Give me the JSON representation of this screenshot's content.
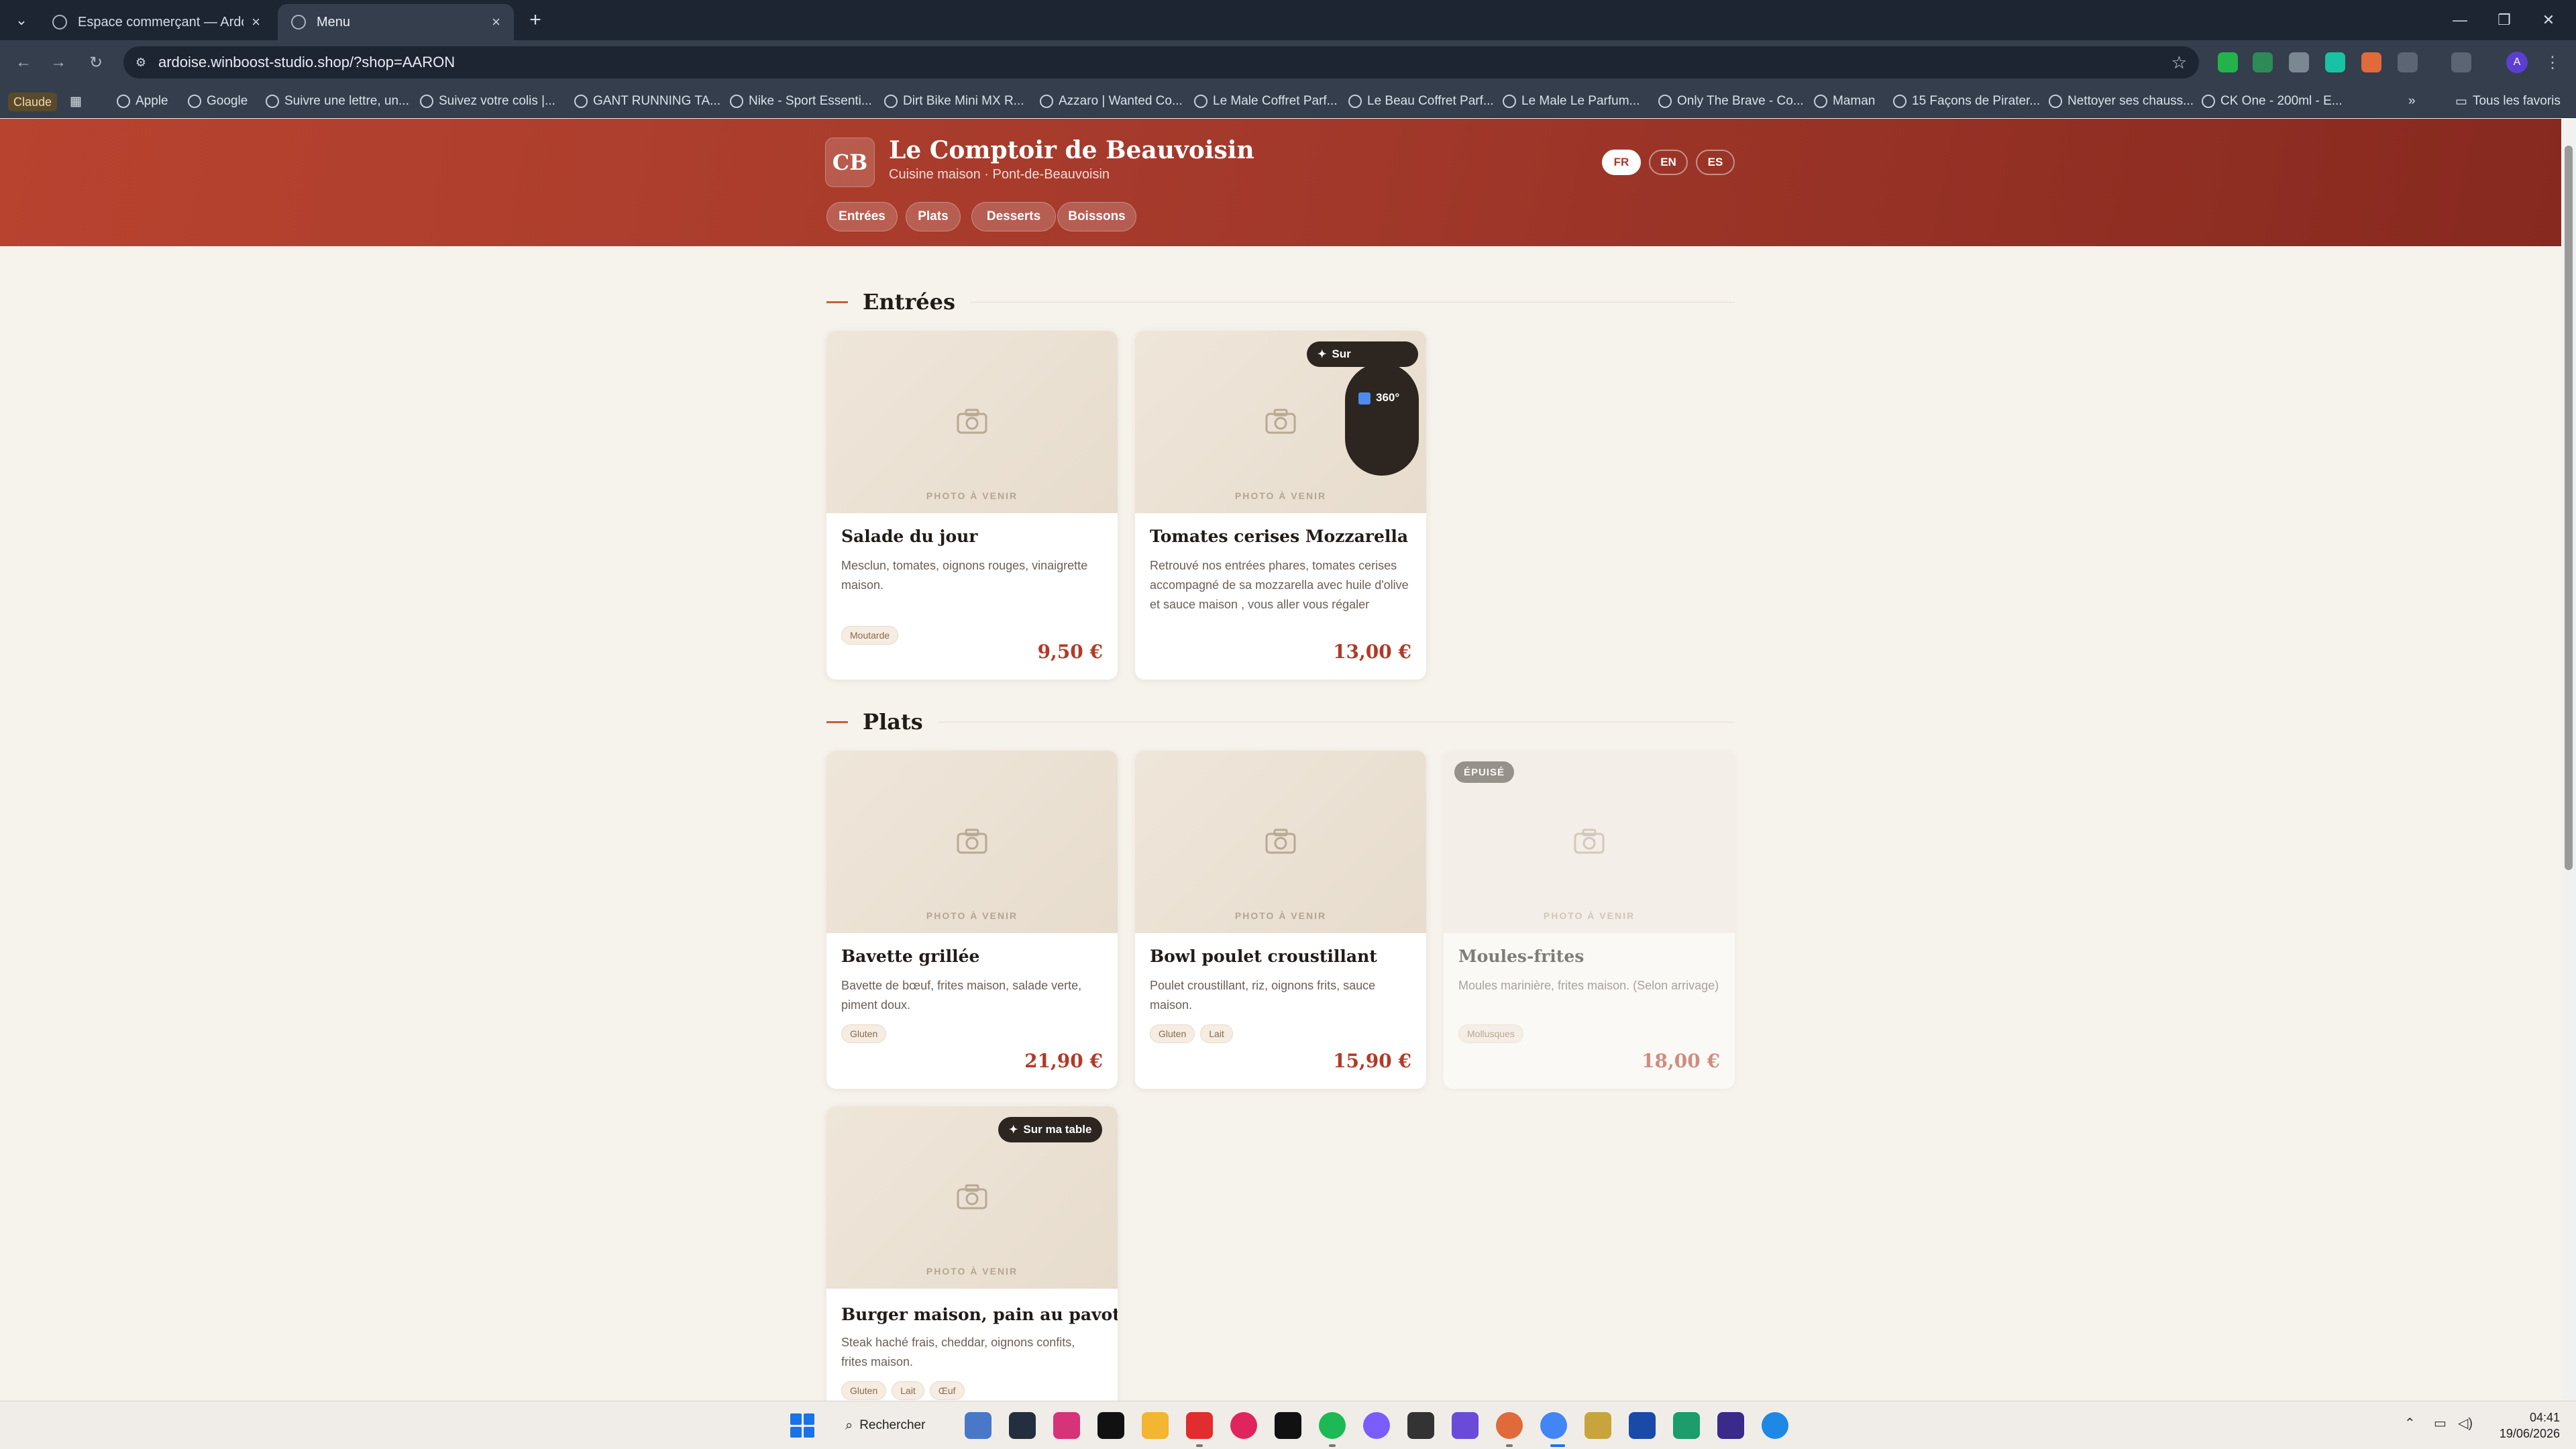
{
  "browser": {
    "tabs": [
      {
        "title": "Espace commerçant — Ardoise",
        "active": false
      },
      {
        "title": "Menu",
        "active": true
      }
    ],
    "url": "ardoise.winboost-studio.shop/?shop=AARON",
    "profile_initial": "A",
    "bookmarks": [
      "Claude",
      "Apple",
      "Google",
      "Suivre une lettre, un...",
      "Suivez votre colis |...",
      "GANT RUNNING TA...",
      "Nike - Sport Essenti...",
      "Dirt Bike Mini MX R...",
      "Azzaro | Wanted Co...",
      "Le Male Coffret Parf...",
      "Le Beau Coffret Parf...",
      "Le Male Le Parfum...",
      "Only The Brave - Co...",
      "Maman",
      "15 Façons de Pirater...",
      "Nettoyer ses chauss...",
      "CK One - 200ml - E..."
    ],
    "all_bookmarks": "Tous les favoris"
  },
  "restaurant": {
    "logo": "CB",
    "name": "Le Comptoir de Beauvoisin",
    "subtitle": "Cuisine maison · Pont-de-Beauvoisin",
    "languages": [
      "FR",
      "EN",
      "ES"
    ],
    "active_language": "FR",
    "categories": [
      "Entrées",
      "Plats",
      "Desserts",
      "Boissons"
    ]
  },
  "photo_placeholder": "PHOTO À VENIR",
  "badges": {
    "featured": "Sur ma table",
    "featured_partial": "Sur",
    "vr": "360°",
    "sold_out": "ÉPUISÉ"
  },
  "sections": [
    {
      "title": "Entrées",
      "items": [
        {
          "name": "Salade du jour",
          "desc": "Mesclun, tomates, oignons rouges, vinaigrette maison.",
          "allergens": [
            "Moutarde"
          ],
          "price": "9,50 €"
        },
        {
          "name": "Tomates cerises Mozzarella",
          "desc": "Retrouvé nos entrées phares, tomates cerises accompagné de sa mozzarella avec huile d'olive et sauce maison , vous aller vous régaler",
          "allergens": [],
          "price": "13,00 €"
        }
      ]
    },
    {
      "title": "Plats",
      "items": [
        {
          "name": "Bavette grillée",
          "desc": "Bavette de bœuf, frites maison, salade verte, piment doux.",
          "allergens": [
            "Gluten"
          ],
          "price": "21,90 €"
        },
        {
          "name": "Bowl poulet croustillant",
          "desc": "Poulet croustillant, riz, oignons frits, sauce maison.",
          "allergens": [
            "Gluten",
            "Lait"
          ],
          "price": "15,90 €"
        },
        {
          "name": "Moules-frites",
          "desc": "Moules marinière, frites maison. (Selon arrivage)",
          "allergens": [
            "Mollusques"
          ],
          "price": "18,00 €"
        },
        {
          "name": "Burger maison, pain au pavot",
          "desc": "Steak haché frais, cheddar, oignons confits, frites maison.",
          "allergens": [
            "Gluten",
            "Lait",
            "Œuf"
          ],
          "price": ""
        }
      ]
    }
  ],
  "taskbar": {
    "search": "Rechercher",
    "time": "04:41",
    "date": "19/06/2026"
  }
}
